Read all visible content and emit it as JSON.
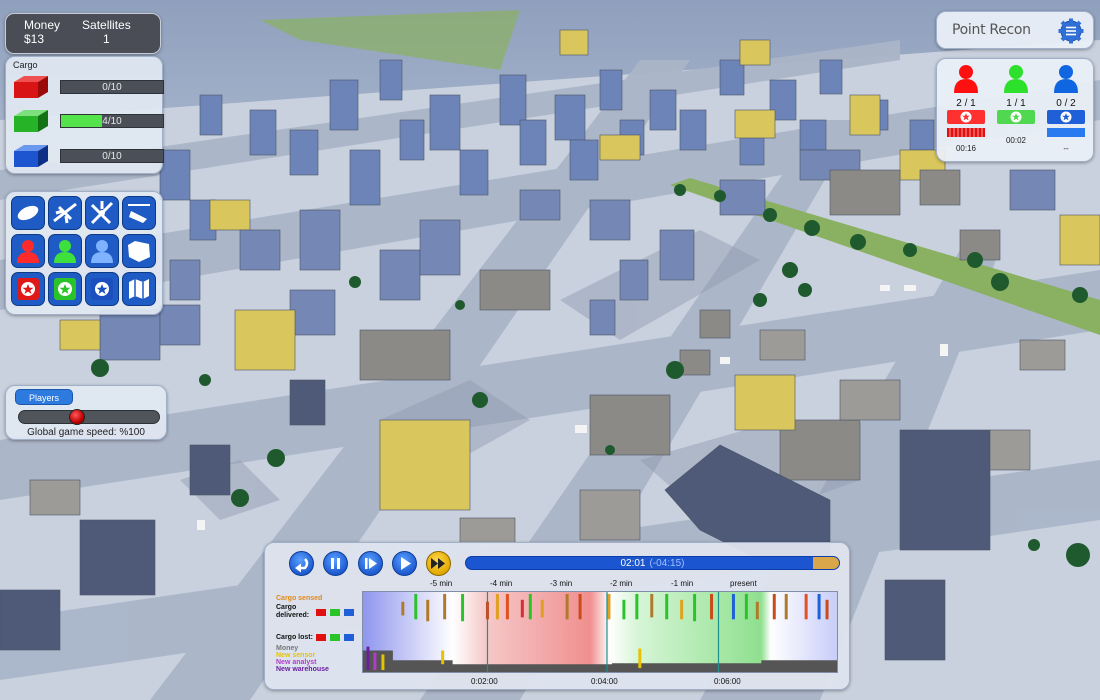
{
  "stats": {
    "money_label": "Money",
    "money_value": "$13",
    "satellites_label": "Satellites",
    "satellites_value": "1"
  },
  "cargo": {
    "title": "Cargo",
    "rows": [
      {
        "color": "#e02020",
        "text": "0/10",
        "fraction": 0.0
      },
      {
        "color": "#2bbf2b",
        "text": "4/10",
        "fraction": 0.4
      },
      {
        "color": "#1f5fd8",
        "text": "0/10",
        "fraction": 0.0
      }
    ]
  },
  "tools": [
    "satellite-icon",
    "plane-icon",
    "drone-icon",
    "helicopter-icon",
    "red-agent-icon",
    "green-agent-icon",
    "blue-agent-icon",
    "map-region-icon",
    "red-base-icon",
    "green-base-icon",
    "blue-base-icon",
    "map-icon"
  ],
  "speed": {
    "players_label": "Players",
    "label": "Global game speed: %100",
    "level": 0.4
  },
  "mode": {
    "title": "Point Recon"
  },
  "teams": [
    {
      "color": "#ff1010",
      "score": "2 / 1",
      "time": "00:16"
    },
    {
      "color": "#2ce02c",
      "score": "1 / 1",
      "time": "00:02"
    },
    {
      "color": "#1066e0",
      "score": "0 / 2",
      "time": "--"
    }
  ],
  "timeline": {
    "current": "02:01",
    "remaining": "(-04:15)",
    "progress": 0.93,
    "top_ticks": [
      "-5 min",
      "-4 min",
      "-3 min",
      "-2 min",
      "-1 min",
      "present"
    ],
    "bottom_ticks": [
      "0:02:00",
      "0:04:00",
      "0:06:00"
    ],
    "legend": {
      "cargo_sensed": "Cargo sensed",
      "cargo_delivered": "Cargo\ndelivered:",
      "cargo_lost": "Cargo lost:",
      "money": "Money",
      "new_sensor": "New sensor",
      "new_analyst": "New analyst",
      "new_warehouse": "New warehouse"
    }
  },
  "colors": {
    "accent_blue": "#1f5bc4",
    "team_red": "#ff1010",
    "team_green": "#2ce02c",
    "team_blue": "#1066e0"
  }
}
